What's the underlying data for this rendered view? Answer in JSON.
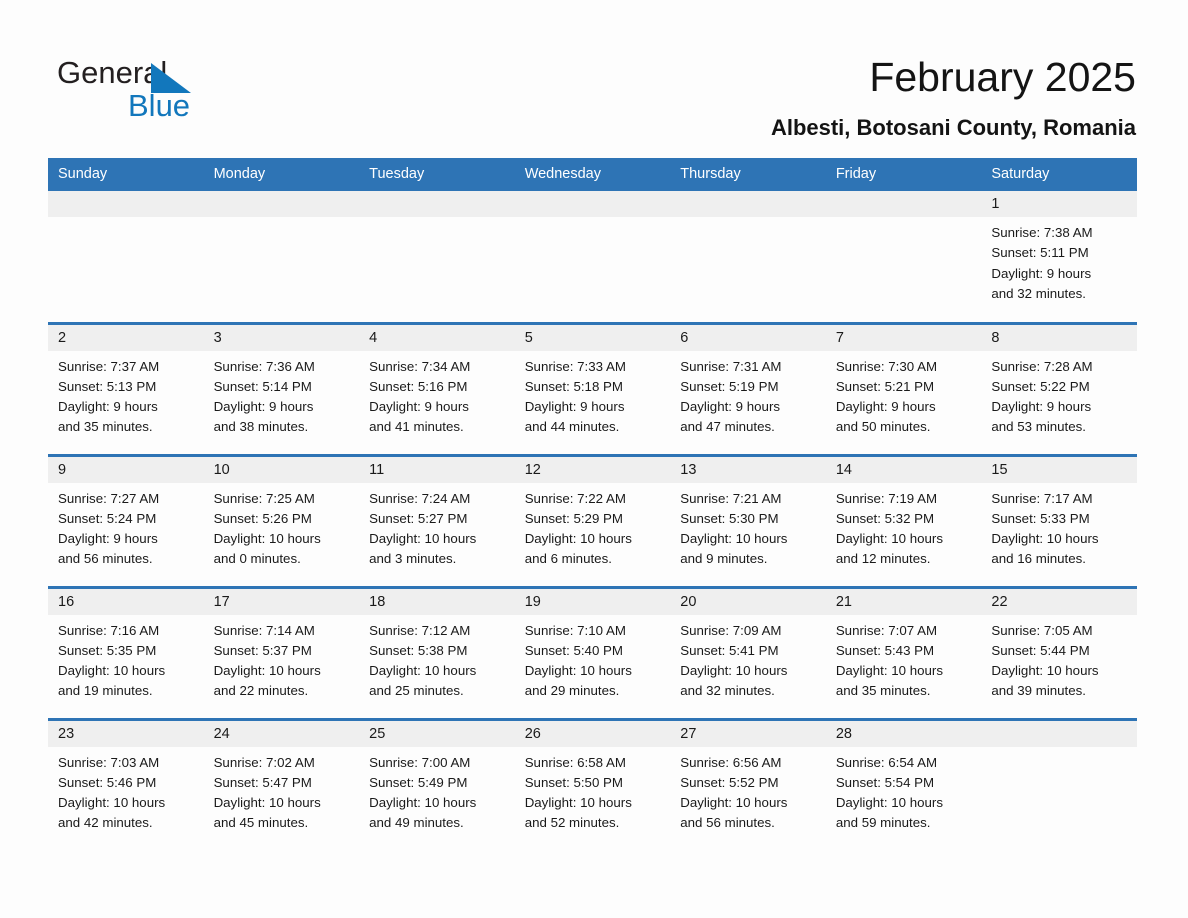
{
  "logo": {
    "word_one": "General",
    "word_two": "Blue",
    "triangle_color": "#1277bc",
    "text_color": "#231f20"
  },
  "header": {
    "title": "February 2025",
    "location": "Albesti, Botosani County, Romania"
  },
  "colors": {
    "header_bar": "#2e74b5",
    "daynum_band": "#efefef",
    "row_rule": "#2e74b5",
    "page_background": "#fdfdfd",
    "text": "#1a1a1a"
  },
  "weekday_headers": [
    "Sunday",
    "Monday",
    "Tuesday",
    "Wednesday",
    "Thursday",
    "Friday",
    "Saturday"
  ],
  "weeks": [
    [
      {
        "day": "",
        "empty": true
      },
      {
        "day": "",
        "empty": true
      },
      {
        "day": "",
        "empty": true
      },
      {
        "day": "",
        "empty": true
      },
      {
        "day": "",
        "empty": true
      },
      {
        "day": "",
        "empty": true
      },
      {
        "day": "1",
        "sunrise": "Sunrise: 7:38 AM",
        "sunset": "Sunset: 5:11 PM",
        "daylight_line1": "Daylight: 9 hours",
        "daylight_line2": "and 32 minutes."
      }
    ],
    [
      {
        "day": "2",
        "sunrise": "Sunrise: 7:37 AM",
        "sunset": "Sunset: 5:13 PM",
        "daylight_line1": "Daylight: 9 hours",
        "daylight_line2": "and 35 minutes."
      },
      {
        "day": "3",
        "sunrise": "Sunrise: 7:36 AM",
        "sunset": "Sunset: 5:14 PM",
        "daylight_line1": "Daylight: 9 hours",
        "daylight_line2": "and 38 minutes."
      },
      {
        "day": "4",
        "sunrise": "Sunrise: 7:34 AM",
        "sunset": "Sunset: 5:16 PM",
        "daylight_line1": "Daylight: 9 hours",
        "daylight_line2": "and 41 minutes."
      },
      {
        "day": "5",
        "sunrise": "Sunrise: 7:33 AM",
        "sunset": "Sunset: 5:18 PM",
        "daylight_line1": "Daylight: 9 hours",
        "daylight_line2": "and 44 minutes."
      },
      {
        "day": "6",
        "sunrise": "Sunrise: 7:31 AM",
        "sunset": "Sunset: 5:19 PM",
        "daylight_line1": "Daylight: 9 hours",
        "daylight_line2": "and 47 minutes."
      },
      {
        "day": "7",
        "sunrise": "Sunrise: 7:30 AM",
        "sunset": "Sunset: 5:21 PM",
        "daylight_line1": "Daylight: 9 hours",
        "daylight_line2": "and 50 minutes."
      },
      {
        "day": "8",
        "sunrise": "Sunrise: 7:28 AM",
        "sunset": "Sunset: 5:22 PM",
        "daylight_line1": "Daylight: 9 hours",
        "daylight_line2": "and 53 minutes."
      }
    ],
    [
      {
        "day": "9",
        "sunrise": "Sunrise: 7:27 AM",
        "sunset": "Sunset: 5:24 PM",
        "daylight_line1": "Daylight: 9 hours",
        "daylight_line2": "and 56 minutes."
      },
      {
        "day": "10",
        "sunrise": "Sunrise: 7:25 AM",
        "sunset": "Sunset: 5:26 PM",
        "daylight_line1": "Daylight: 10 hours",
        "daylight_line2": "and 0 minutes."
      },
      {
        "day": "11",
        "sunrise": "Sunrise: 7:24 AM",
        "sunset": "Sunset: 5:27 PM",
        "daylight_line1": "Daylight: 10 hours",
        "daylight_line2": "and 3 minutes."
      },
      {
        "day": "12",
        "sunrise": "Sunrise: 7:22 AM",
        "sunset": "Sunset: 5:29 PM",
        "daylight_line1": "Daylight: 10 hours",
        "daylight_line2": "and 6 minutes."
      },
      {
        "day": "13",
        "sunrise": "Sunrise: 7:21 AM",
        "sunset": "Sunset: 5:30 PM",
        "daylight_line1": "Daylight: 10 hours",
        "daylight_line2": "and 9 minutes."
      },
      {
        "day": "14",
        "sunrise": "Sunrise: 7:19 AM",
        "sunset": "Sunset: 5:32 PM",
        "daylight_line1": "Daylight: 10 hours",
        "daylight_line2": "and 12 minutes."
      },
      {
        "day": "15",
        "sunrise": "Sunrise: 7:17 AM",
        "sunset": "Sunset: 5:33 PM",
        "daylight_line1": "Daylight: 10 hours",
        "daylight_line2": "and 16 minutes."
      }
    ],
    [
      {
        "day": "16",
        "sunrise": "Sunrise: 7:16 AM",
        "sunset": "Sunset: 5:35 PM",
        "daylight_line1": "Daylight: 10 hours",
        "daylight_line2": "and 19 minutes."
      },
      {
        "day": "17",
        "sunrise": "Sunrise: 7:14 AM",
        "sunset": "Sunset: 5:37 PM",
        "daylight_line1": "Daylight: 10 hours",
        "daylight_line2": "and 22 minutes."
      },
      {
        "day": "18",
        "sunrise": "Sunrise: 7:12 AM",
        "sunset": "Sunset: 5:38 PM",
        "daylight_line1": "Daylight: 10 hours",
        "daylight_line2": "and 25 minutes."
      },
      {
        "day": "19",
        "sunrise": "Sunrise: 7:10 AM",
        "sunset": "Sunset: 5:40 PM",
        "daylight_line1": "Daylight: 10 hours",
        "daylight_line2": "and 29 minutes."
      },
      {
        "day": "20",
        "sunrise": "Sunrise: 7:09 AM",
        "sunset": "Sunset: 5:41 PM",
        "daylight_line1": "Daylight: 10 hours",
        "daylight_line2": "and 32 minutes."
      },
      {
        "day": "21",
        "sunrise": "Sunrise: 7:07 AM",
        "sunset": "Sunset: 5:43 PM",
        "daylight_line1": "Daylight: 10 hours",
        "daylight_line2": "and 35 minutes."
      },
      {
        "day": "22",
        "sunrise": "Sunrise: 7:05 AM",
        "sunset": "Sunset: 5:44 PM",
        "daylight_line1": "Daylight: 10 hours",
        "daylight_line2": "and 39 minutes."
      }
    ],
    [
      {
        "day": "23",
        "sunrise": "Sunrise: 7:03 AM",
        "sunset": "Sunset: 5:46 PM",
        "daylight_line1": "Daylight: 10 hours",
        "daylight_line2": "and 42 minutes."
      },
      {
        "day": "24",
        "sunrise": "Sunrise: 7:02 AM",
        "sunset": "Sunset: 5:47 PM",
        "daylight_line1": "Daylight: 10 hours",
        "daylight_line2": "and 45 minutes."
      },
      {
        "day": "25",
        "sunrise": "Sunrise: 7:00 AM",
        "sunset": "Sunset: 5:49 PM",
        "daylight_line1": "Daylight: 10 hours",
        "daylight_line2": "and 49 minutes."
      },
      {
        "day": "26",
        "sunrise": "Sunrise: 6:58 AM",
        "sunset": "Sunset: 5:50 PM",
        "daylight_line1": "Daylight: 10 hours",
        "daylight_line2": "and 52 minutes."
      },
      {
        "day": "27",
        "sunrise": "Sunrise: 6:56 AM",
        "sunset": "Sunset: 5:52 PM",
        "daylight_line1": "Daylight: 10 hours",
        "daylight_line2": "and 56 minutes."
      },
      {
        "day": "28",
        "sunrise": "Sunrise: 6:54 AM",
        "sunset": "Sunset: 5:54 PM",
        "daylight_line1": "Daylight: 10 hours",
        "daylight_line2": "and 59 minutes."
      },
      {
        "day": "",
        "empty": true
      }
    ]
  ]
}
